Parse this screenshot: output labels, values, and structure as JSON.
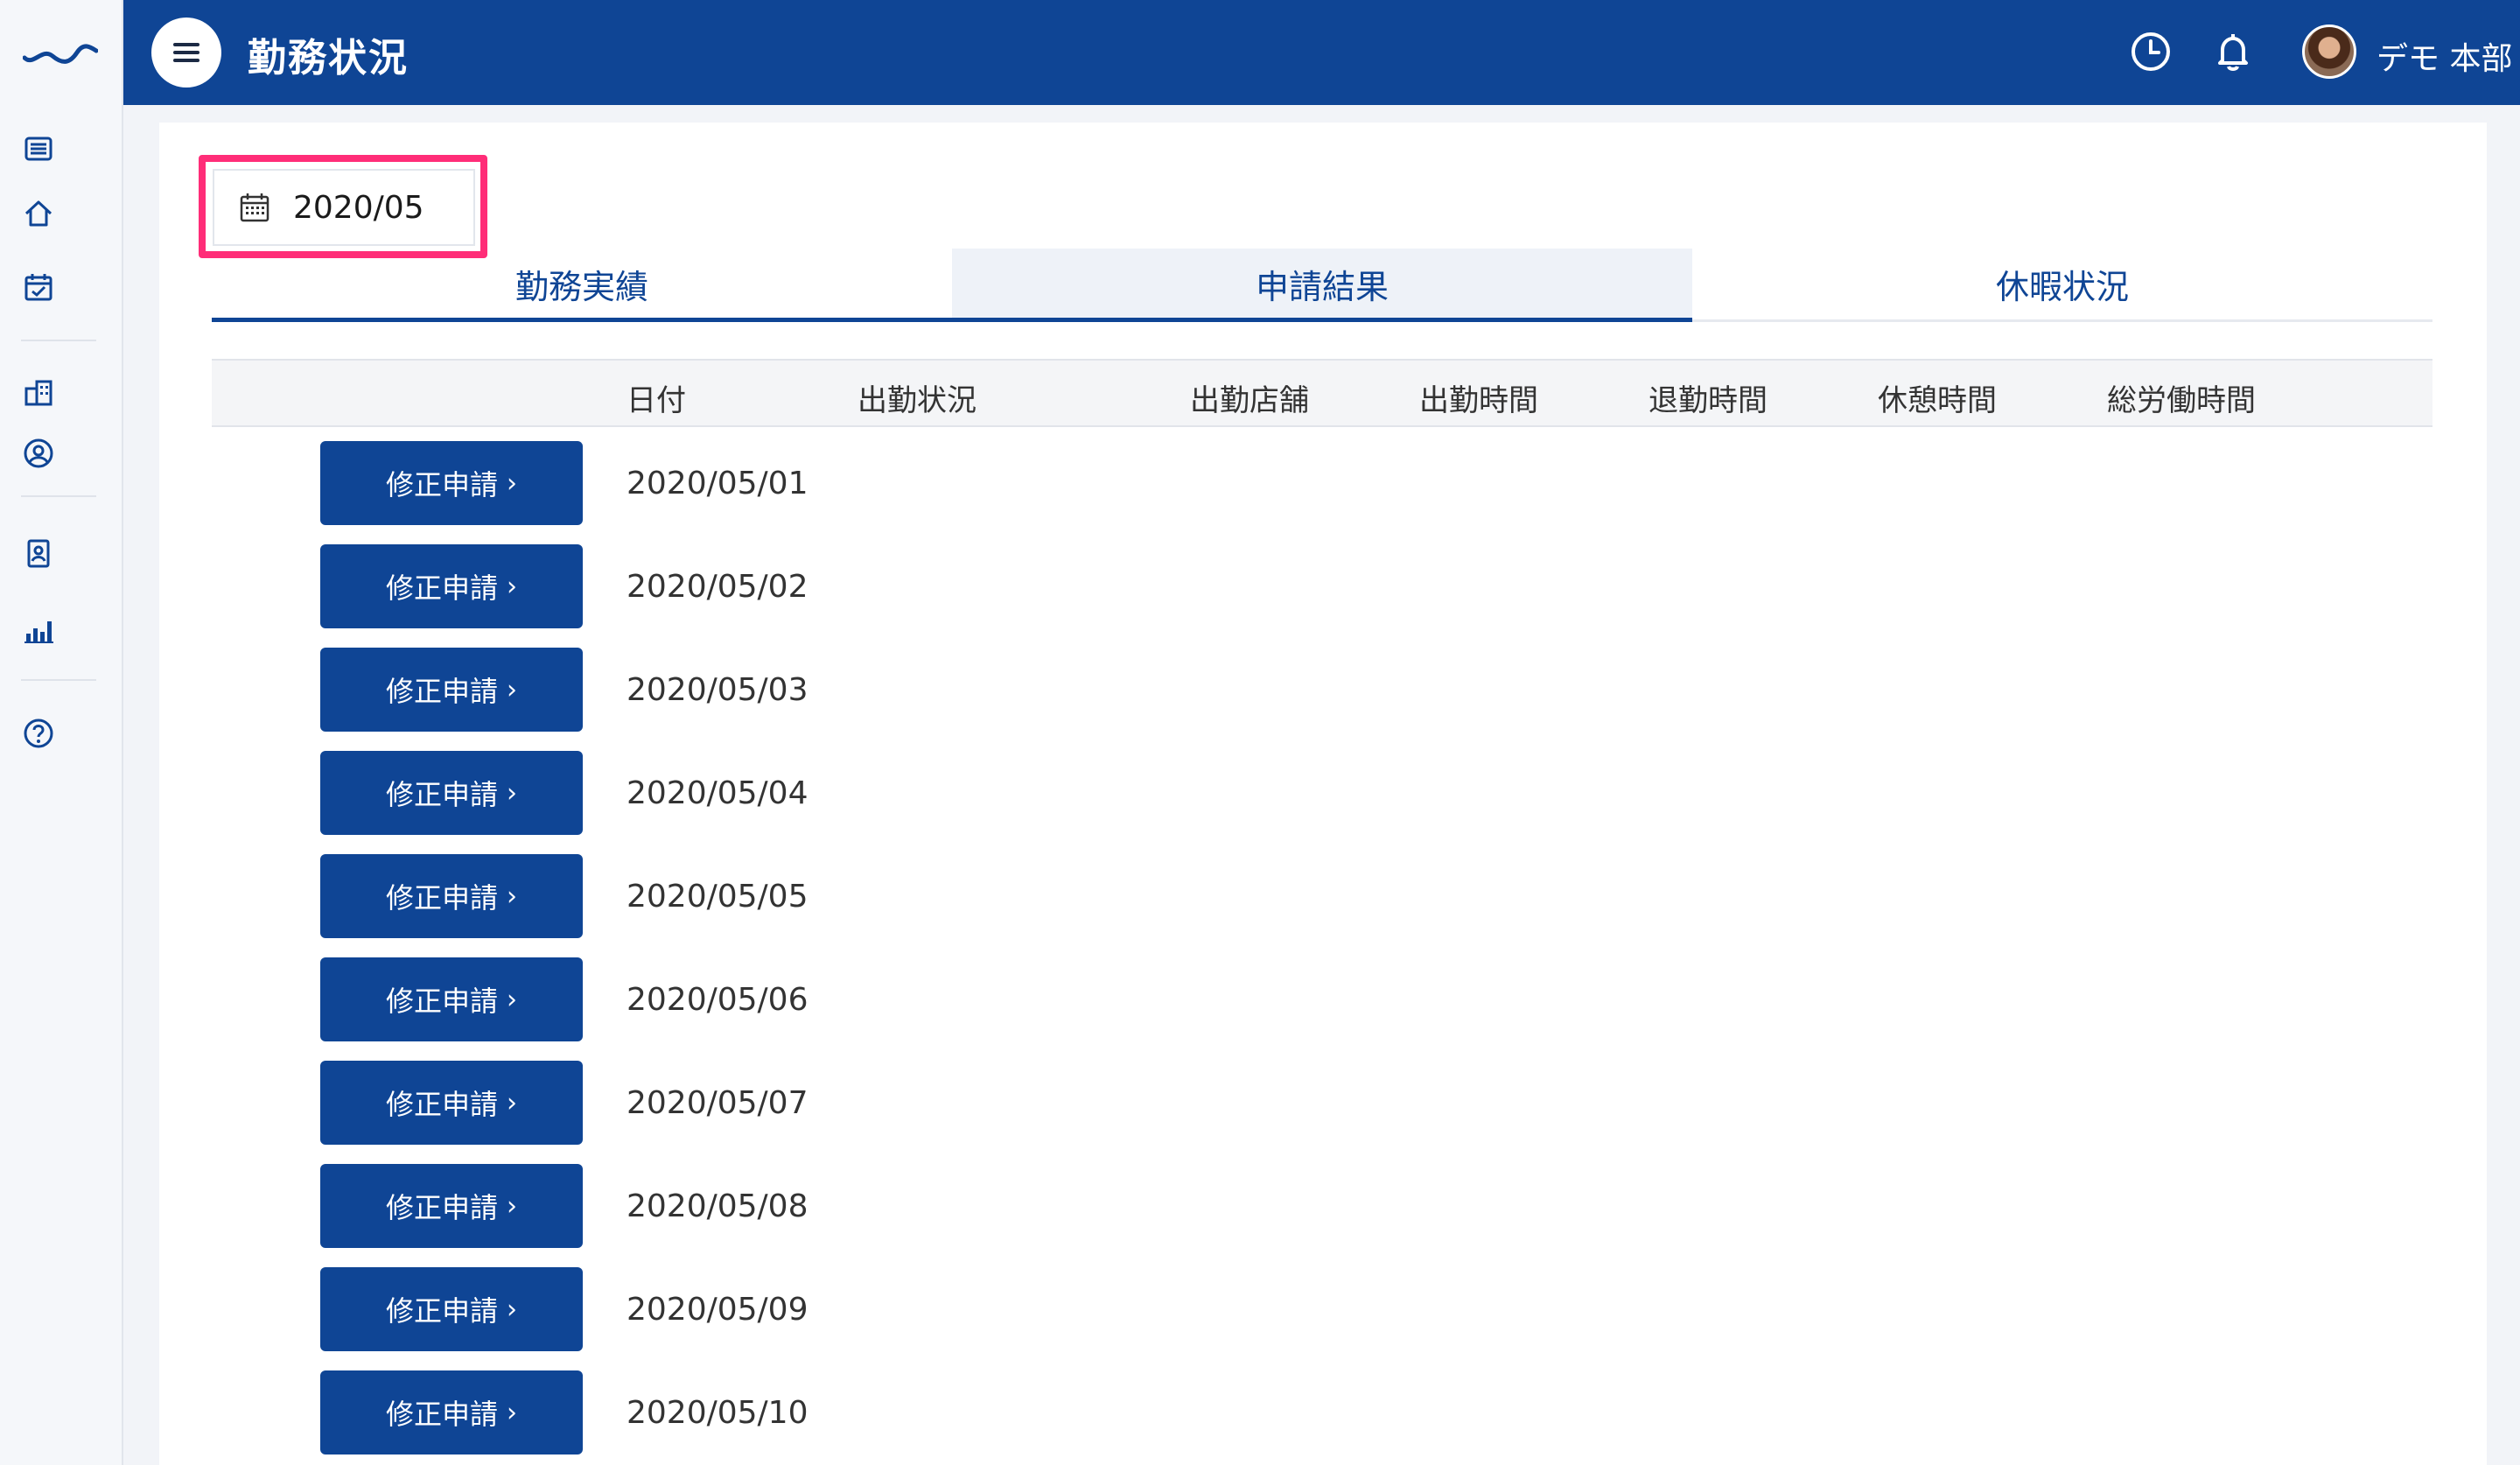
{
  "header": {
    "title": "勤務状況",
    "user_name": "デモ 本部"
  },
  "month_picker": {
    "value": "2020/05"
  },
  "tabs": [
    {
      "label": "勤務実績"
    },
    {
      "label": "申請結果"
    },
    {
      "label": "休暇状況"
    }
  ],
  "table": {
    "columns": [
      "日付",
      "出勤状況",
      "出勤店舗",
      "出勤時間",
      "退勤時間",
      "休憩時間",
      "総労働時間"
    ],
    "button_label": "修正申請",
    "button_chevron": "›",
    "rows": [
      {
        "date": "2020/05/01"
      },
      {
        "date": "2020/05/02"
      },
      {
        "date": "2020/05/03"
      },
      {
        "date": "2020/05/04"
      },
      {
        "date": "2020/05/05"
      },
      {
        "date": "2020/05/06"
      },
      {
        "date": "2020/05/07"
      },
      {
        "date": "2020/05/08"
      },
      {
        "date": "2020/05/09"
      },
      {
        "date": "2020/05/10"
      }
    ]
  },
  "sidebar": {
    "icons": [
      "list-icon",
      "home-icon",
      "calendar-check-icon",
      "building-icon",
      "user-circle-icon",
      "id-badge-icon",
      "bar-chart-icon",
      "help-icon"
    ]
  },
  "colors": {
    "primary": "#0f4595",
    "highlight": "#ff2d78",
    "background": "#f2f4f8"
  }
}
